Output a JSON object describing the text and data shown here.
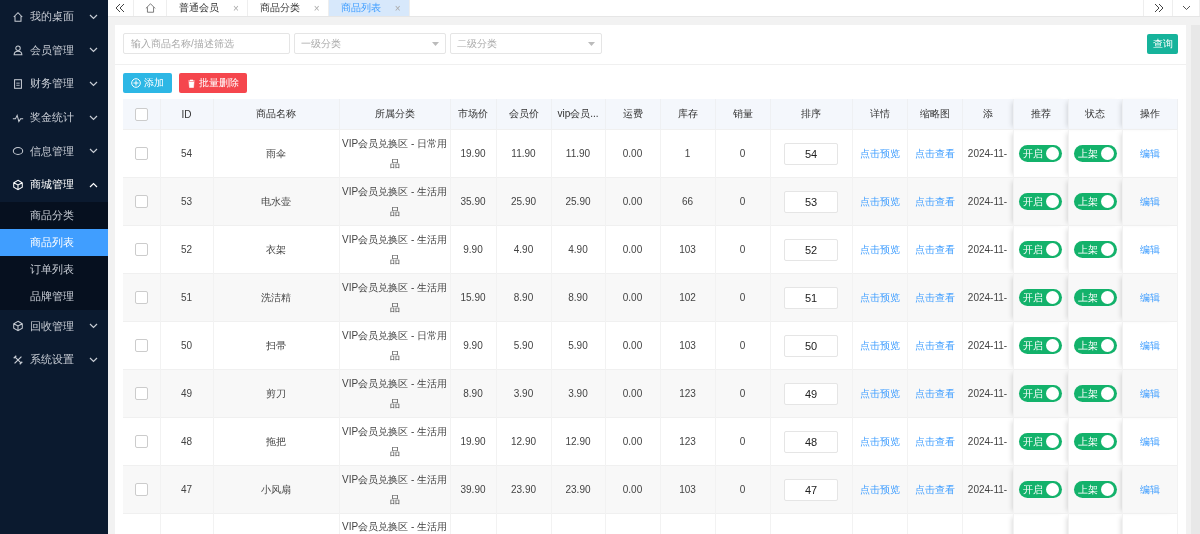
{
  "sidebar": {
    "items": [
      {
        "label": "我的桌面",
        "expanded": false
      },
      {
        "label": "会员管理",
        "expanded": false
      },
      {
        "label": "财务管理",
        "expanded": false
      },
      {
        "label": "奖金统计",
        "expanded": false
      },
      {
        "label": "信息管理",
        "expanded": false
      },
      {
        "label": "商城管理",
        "expanded": true,
        "children": [
          {
            "label": "商品分类",
            "selected": false
          },
          {
            "label": "商品列表",
            "selected": true
          },
          {
            "label": "订单列表",
            "selected": false
          },
          {
            "label": "品牌管理",
            "selected": false
          }
        ]
      },
      {
        "label": "回收管理",
        "expanded": false
      },
      {
        "label": "系统设置",
        "expanded": false
      }
    ]
  },
  "tabs": [
    {
      "label": "普通会员",
      "close": "×",
      "selected": false
    },
    {
      "label": "商品分类",
      "close": "×",
      "selected": false
    },
    {
      "label": "商品列表",
      "close": "×",
      "selected": true
    }
  ],
  "filters": {
    "search": {
      "placeholder": "输入商品名称/描述筛选"
    },
    "selects": [
      {
        "placeholder": "一级分类"
      },
      {
        "placeholder": "二级分类"
      }
    ],
    "query_button": "查询"
  },
  "actions": [
    {
      "label": "添加",
      "kind": "add"
    },
    {
      "label": "批量删除",
      "kind": "delete"
    }
  ],
  "table": {
    "select_all_checked": false,
    "columns": [
      "ID",
      "商品名称",
      "所属分类",
      "市场价",
      "会员价",
      "vip会员...",
      "运费",
      "库存",
      "销量",
      "排序",
      "详情",
      "缩略图",
      "添",
      "推荐",
      "状态",
      "操作"
    ],
    "rows": [
      {
        "checked": false,
        "id": "54",
        "name": "雨伞",
        "category": "VIP会员兑换区 - 日常用品",
        "market": "19.90",
        "member": "11.90",
        "vip": "11.90",
        "shipping": "0.00",
        "stock": "1",
        "sales": "0",
        "sort": "54",
        "detail": "点击预览",
        "thumb": "点击查看",
        "added": "2024-11-",
        "recommend": {
          "label": "开启",
          "on": true
        },
        "status": {
          "label": "上架",
          "on": true
        },
        "edit": "编辑"
      },
      {
        "checked": false,
        "id": "53",
        "name": "电水壶",
        "category": "VIP会员兑换区 - 生活用品",
        "market": "35.90",
        "member": "25.90",
        "vip": "25.90",
        "shipping": "0.00",
        "stock": "66",
        "sales": "0",
        "sort": "53",
        "detail": "点击预览",
        "thumb": "点击查看",
        "added": "2024-11-",
        "recommend": {
          "label": "开启",
          "on": true
        },
        "status": {
          "label": "上架",
          "on": true
        },
        "edit": "编辑"
      },
      {
        "checked": false,
        "id": "52",
        "name": "衣架",
        "category": "VIP会员兑换区 - 生活用品",
        "market": "9.90",
        "member": "4.90",
        "vip": "4.90",
        "shipping": "0.00",
        "stock": "103",
        "sales": "0",
        "sort": "52",
        "detail": "点击预览",
        "thumb": "点击查看",
        "added": "2024-11-",
        "recommend": {
          "label": "开启",
          "on": true
        },
        "status": {
          "label": "上架",
          "on": true
        },
        "edit": "编辑"
      },
      {
        "checked": false,
        "id": "51",
        "name": "洗洁精",
        "category": "VIP会员兑换区 - 生活用品",
        "market": "15.90",
        "member": "8.90",
        "vip": "8.90",
        "shipping": "0.00",
        "stock": "102",
        "sales": "0",
        "sort": "51",
        "detail": "点击预览",
        "thumb": "点击查看",
        "added": "2024-11-",
        "recommend": {
          "label": "开启",
          "on": true
        },
        "status": {
          "label": "上架",
          "on": true
        },
        "edit": "编辑"
      },
      {
        "checked": false,
        "id": "50",
        "name": "扫帚",
        "category": "VIP会员兑换区 - 日常用品",
        "market": "9.90",
        "member": "5.90",
        "vip": "5.90",
        "shipping": "0.00",
        "stock": "103",
        "sales": "0",
        "sort": "50",
        "detail": "点击预览",
        "thumb": "点击查看",
        "added": "2024-11-",
        "recommend": {
          "label": "开启",
          "on": true
        },
        "status": {
          "label": "上架",
          "on": true
        },
        "edit": "编辑"
      },
      {
        "checked": false,
        "id": "49",
        "name": "剪刀",
        "category": "VIP会员兑换区 - 生活用品",
        "market": "8.90",
        "member": "3.90",
        "vip": "3.90",
        "shipping": "0.00",
        "stock": "123",
        "sales": "0",
        "sort": "49",
        "detail": "点击预览",
        "thumb": "点击查看",
        "added": "2024-11-",
        "recommend": {
          "label": "开启",
          "on": true
        },
        "status": {
          "label": "上架",
          "on": true
        },
        "edit": "编辑"
      },
      {
        "checked": false,
        "id": "48",
        "name": "拖把",
        "category": "VIP会员兑换区 - 生活用品",
        "market": "19.90",
        "member": "12.90",
        "vip": "12.90",
        "shipping": "0.00",
        "stock": "123",
        "sales": "0",
        "sort": "48",
        "detail": "点击预览",
        "thumb": "点击查看",
        "added": "2024-11-",
        "recommend": {
          "label": "开启",
          "on": true
        },
        "status": {
          "label": "上架",
          "on": true
        },
        "edit": "编辑"
      },
      {
        "checked": false,
        "id": "47",
        "name": "小风扇",
        "category": "VIP会员兑换区 - 生活用品",
        "market": "39.90",
        "member": "23.90",
        "vip": "23.90",
        "shipping": "0.00",
        "stock": "103",
        "sales": "0",
        "sort": "47",
        "detail": "点击预览",
        "thumb": "点击查看",
        "added": "2024-11-",
        "recommend": {
          "label": "开启",
          "on": true
        },
        "status": {
          "label": "上架",
          "on": true
        },
        "edit": "编辑"
      },
      {
        "category": "VIP会员兑换区 - 生活用"
      }
    ]
  }
}
